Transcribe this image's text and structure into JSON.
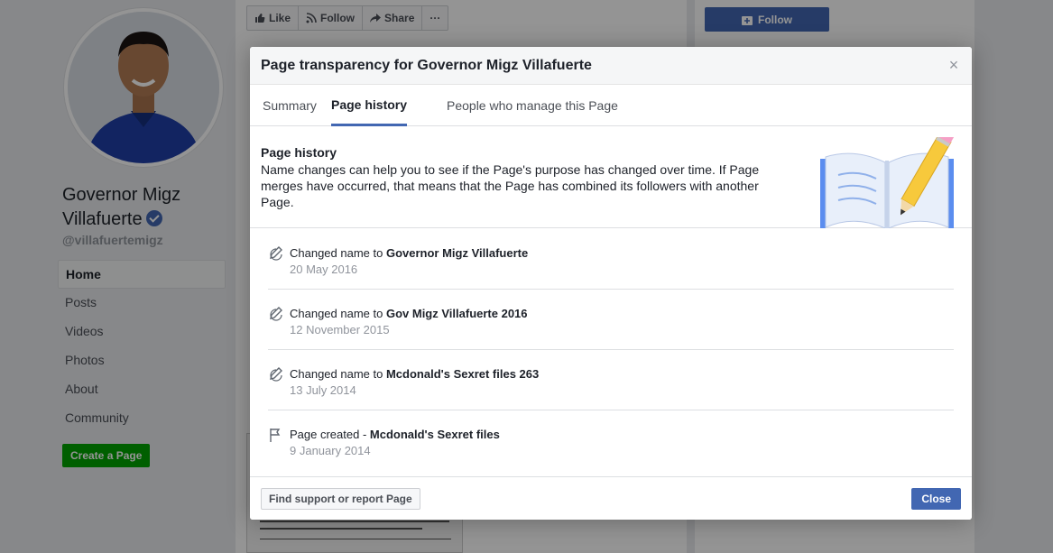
{
  "profile": {
    "name_line1": "Governor Migz",
    "name_line2": "Villafuerte",
    "handle": "@villafuertemigz"
  },
  "nav": [
    {
      "label": "Home",
      "active": true
    },
    {
      "label": "Posts"
    },
    {
      "label": "Videos"
    },
    {
      "label": "Photos"
    },
    {
      "label": "About"
    },
    {
      "label": "Community"
    }
  ],
  "create_page_label": "Create a Page",
  "actions": {
    "like": "Like",
    "follow": "Follow",
    "share": "Share",
    "more": "···"
  },
  "right_follow_label": "Follow",
  "modal": {
    "title": "Page transparency for Governor Migz Villafuerte",
    "close_glyph": "×",
    "tabs": [
      {
        "label": "Summary"
      },
      {
        "label": "Page history",
        "active": true
      },
      {
        "label": "People who manage this Page"
      }
    ],
    "intro": {
      "heading": "Page history",
      "text": "Name changes can help you to see if the Page's purpose has changed over time. If Page merges have occurred, that means that the Page has combined its followers with another Page."
    },
    "history": [
      {
        "icon": "pencil-icon",
        "prefix": "Changed name to ",
        "name": "Governor Migz Villafuerte",
        "date": "20 May 2016"
      },
      {
        "icon": "pencil-icon",
        "prefix": "Changed name to ",
        "name": "Gov Migz Villafuerte 2016",
        "date": "12 November 2015"
      },
      {
        "icon": "pencil-icon",
        "prefix": "Changed name to ",
        "name": "Mcdonald's Sexret files 263",
        "date": "13 July 2014"
      },
      {
        "icon": "flag-icon",
        "prefix": "Page created - ",
        "name": "Mcdonald's Sexret files",
        "date": "9 January 2014"
      }
    ],
    "footer": {
      "report_label": "Find support or report Page",
      "close_label": "Close"
    }
  },
  "colors": {
    "accent": "#4267b2",
    "create_green": "#00a400",
    "muted_text": "#90949c"
  }
}
